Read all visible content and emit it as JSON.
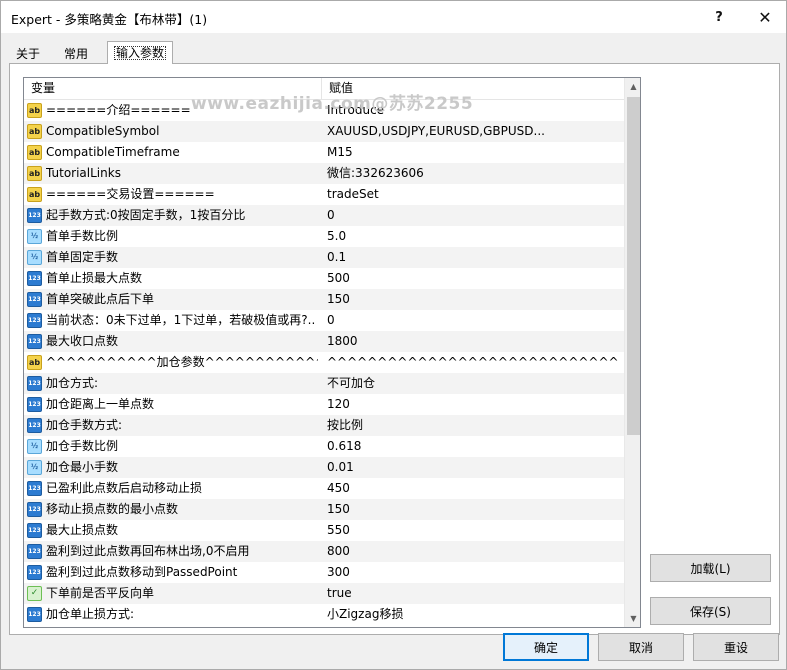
{
  "window": {
    "title": "Expert - 多策略黄金【布林带】(1)",
    "help_label": "?",
    "close_label": "✕"
  },
  "tabs": [
    {
      "label": "关于"
    },
    {
      "label": "常用"
    },
    {
      "label": "输入参数"
    }
  ],
  "grid": {
    "col_variable": "变量",
    "col_value": "赋值",
    "rows": [
      {
        "icon": "ab",
        "name": "======介绍======",
        "value": "Introduce"
      },
      {
        "icon": "ab",
        "name": "CompatibleSymbol",
        "value": "XAUUSD,USDJPY,EURUSD,GBPUSD..."
      },
      {
        "icon": "ab",
        "name": "CompatibleTimeframe",
        "value": "M15"
      },
      {
        "icon": "ab",
        "name": "TutorialLinks",
        "value": "  微信:332623606"
      },
      {
        "icon": "ab",
        "name": "======交易设置======",
        "value": "tradeSet"
      },
      {
        "icon": "num",
        "name": "起手数方式:0按固定手数，1按百分比",
        "value": "0"
      },
      {
        "icon": "frac",
        "name": "首单手数比例",
        "value": "5.0"
      },
      {
        "icon": "frac",
        "name": "首单固定手数",
        "value": "0.1"
      },
      {
        "icon": "num",
        "name": "首单止损最大点数",
        "value": "500"
      },
      {
        "icon": "num",
        "name": "首单突破此点后下单",
        "value": "150"
      },
      {
        "icon": "num",
        "name": "当前状态：0未下过单，1下过单，若破极值或再?..",
        "value": "0"
      },
      {
        "icon": "num",
        "name": "最大收口点数",
        "value": "1800"
      },
      {
        "icon": "ab",
        "name": "^^^^^^^^^^^加仓参数^^^^^^^^^^^^^^^...",
        "value": "^^^^^^^^^^^^^^^^^^^^^^^^^^^^^^^^^^^^^^^..."
      },
      {
        "icon": "num",
        "name": "加仓方式:",
        "value": "不可加仓"
      },
      {
        "icon": "num",
        "name": "加仓距离上一单点数",
        "value": "120"
      },
      {
        "icon": "num",
        "name": "加仓手数方式:",
        "value": "按比例"
      },
      {
        "icon": "frac",
        "name": "加仓手数比例",
        "value": "0.618"
      },
      {
        "icon": "frac",
        "name": "加仓最小手数",
        "value": "0.01"
      },
      {
        "icon": "num",
        "name": "已盈利此点数后启动移动止损",
        "value": "450"
      },
      {
        "icon": "num",
        "name": "移动止损点数的最小点数",
        "value": "150"
      },
      {
        "icon": "num",
        "name": "最大止损点数",
        "value": "550"
      },
      {
        "icon": "num",
        "name": "盈利到过此点数再回布林出场,0不启用",
        "value": "800"
      },
      {
        "icon": "num",
        "name": "盈利到过此点数移动到PassedPoint",
        "value": "300"
      },
      {
        "icon": "bool",
        "name": "下单前是否平反向单",
        "value": "true"
      },
      {
        "icon": "num",
        "name": "加仓单止损方式:",
        "value": "小Zigzag移损"
      }
    ]
  },
  "icon_labels": {
    "ab": "ab",
    "num": "123",
    "frac": "½",
    "bool": "✓"
  },
  "watermark": "www.eazhijia.com@苏苏2255",
  "buttons": {
    "load": "加载(L)",
    "save": "保存(S)",
    "ok": "确定",
    "cancel": "取消",
    "reset": "重设"
  }
}
